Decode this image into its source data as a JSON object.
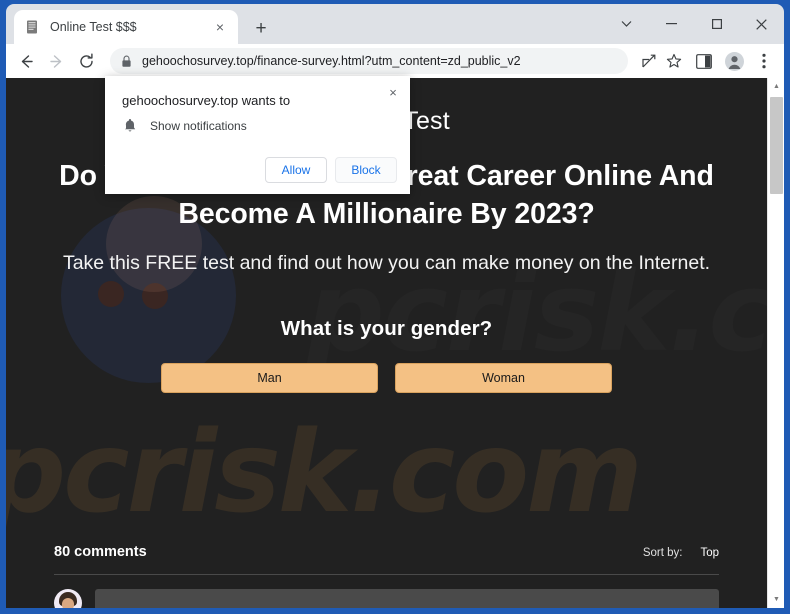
{
  "browser": {
    "tab": {
      "title": "Online Test $$$",
      "favicon": "document-icon",
      "close_label": "×"
    },
    "new_tab_label": "+",
    "window_controls": [
      {
        "name": "tab-search-button",
        "glyph": "⌄"
      },
      {
        "name": "minimize-button",
        "glyph": "–"
      },
      {
        "name": "maximize-button",
        "glyph": "□"
      },
      {
        "name": "close-button",
        "glyph": "×"
      }
    ],
    "toolbar": {
      "back_label": "←",
      "forward_label": "→",
      "reload_label": "↻",
      "url": "gehoochosurvey.top/finance-survey.html?utm_content=zd_public_v2",
      "lock_icon": "lock-icon",
      "share_icon": "share-icon",
      "bookmark_icon": "star-icon",
      "sidepanel_icon": "side-panel-icon",
      "profile_icon": "profile-avatar-icon",
      "menu_icon": "three-dot-menu-icon"
    }
  },
  "permission_popup": {
    "title": "gehoochosurvey.top wants to",
    "permission": "Show notifications",
    "permission_icon": "bell-icon",
    "allow_label": "Allow",
    "block_label": "Block",
    "close_label": "×"
  },
  "page": {
    "hero_title": "Online Test",
    "hero_heading": "Do You Want To Build A Great Career Online And Become A Millionaire By 2023?",
    "hero_subtitle": "Take this FREE test and find out how you can make money on the Internet.",
    "question": "What is your gender?",
    "answers": [
      {
        "label": "Man"
      },
      {
        "label": "Woman"
      }
    ],
    "watermark": "pcrisk.com",
    "watermark_top": "pcrisk.com",
    "comments": {
      "count_label": "80 comments",
      "sort_label": "Sort by:",
      "sort_value": "Top"
    },
    "scrollbar": {
      "up_glyph": "▲",
      "down_glyph": "▼"
    }
  },
  "colors": {
    "frame": "#1f5bb5",
    "tabstrip": "#dee1e6",
    "page_bg": "#212121",
    "accent_button": "#f4c184",
    "accent_button_border": "#d9a25e",
    "link_blue": "#1a73e8"
  }
}
